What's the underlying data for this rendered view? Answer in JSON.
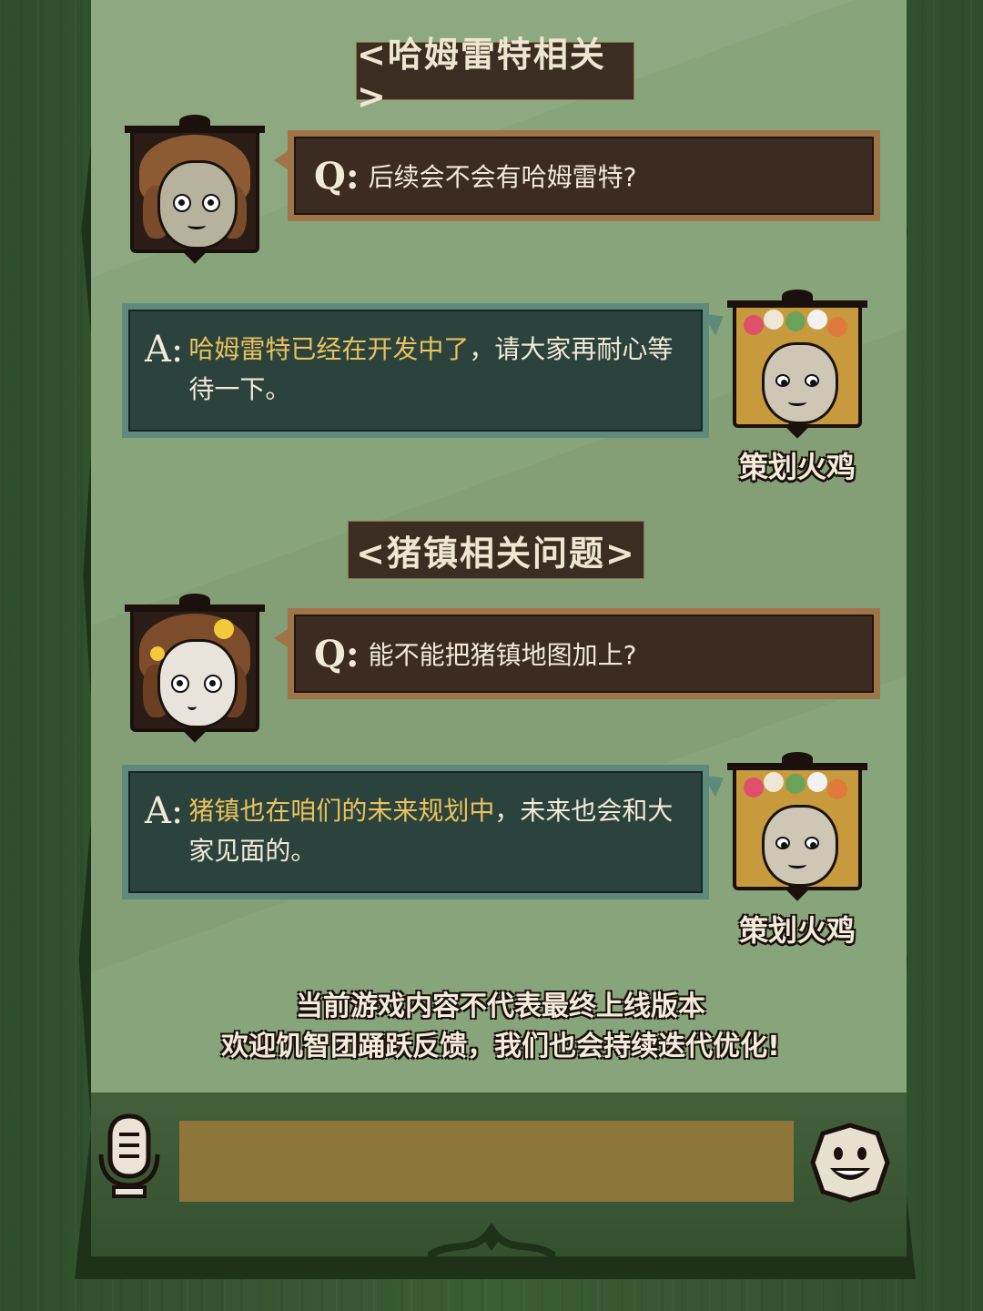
{
  "sections": [
    {
      "title": "<哈姆雷特相关>",
      "question_label": "Q:",
      "question": "后续会不会有哈姆雷特?",
      "answer_label": "A:",
      "answer_highlight": "哈姆雷特已经在开发中了",
      "answer_rest_line1": "，请大家再耐心等",
      "answer_rest_line2": "待一下。",
      "planner_name": "策划火鸡"
    },
    {
      "title": "<猪镇相关问题>",
      "question_label": "Q:",
      "question": "能不能把猪镇地图加上?",
      "answer_label": "A:",
      "answer_highlight": "猪镇也在咱们的未来规划中",
      "answer_rest_line1": "，未来也会和大",
      "answer_rest_line2": "家见面的。",
      "planner_name": "策划火鸡"
    }
  ],
  "footer": {
    "line1": "当前游戏内容不代表最终上线版本",
    "line2": "欢迎饥智团踊跃反馈，我们也会持续迭代优化!"
  },
  "input_bar": {
    "value": ""
  },
  "colors": {
    "paper": "#88a47a",
    "question_bg": "#3c2b21",
    "answer_bg": "#2b433c",
    "highlight": "#e9c25d"
  },
  "icons": [
    "microphone-icon",
    "smiley-face-icon"
  ]
}
